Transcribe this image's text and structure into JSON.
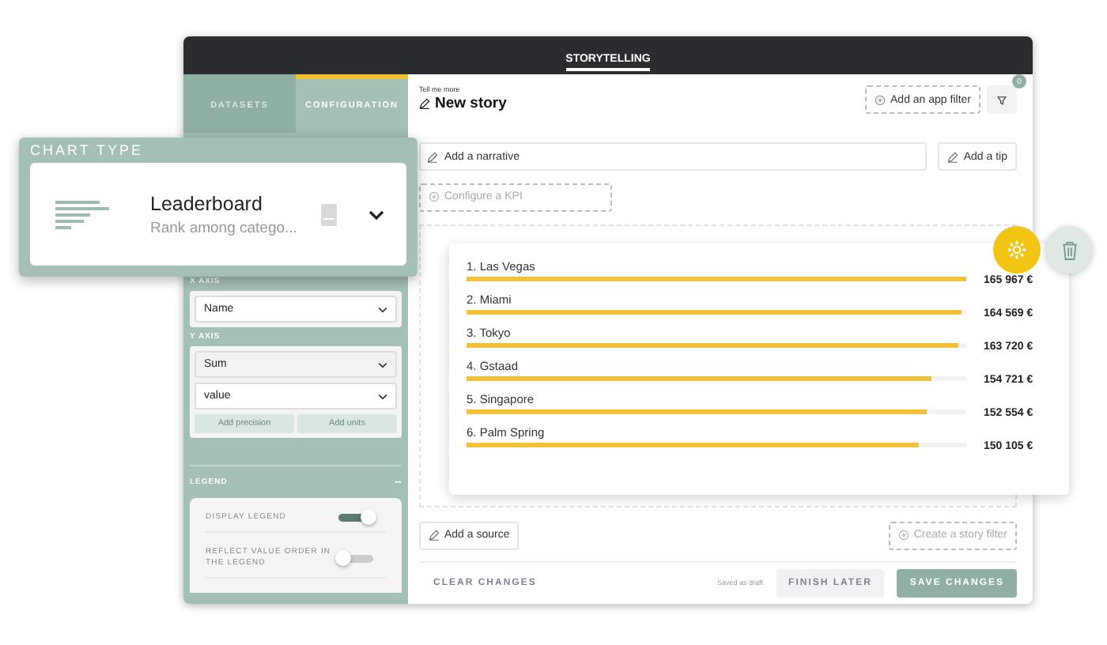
{
  "header": {
    "title": "STORYTELLING"
  },
  "sidebar": {
    "tabs": [
      {
        "label": "DATASETS",
        "selected": false
      },
      {
        "label": "CONFIGURATION",
        "selected": true
      }
    ],
    "x_axis": {
      "label": "X AXIS",
      "select": "Name"
    },
    "y_axis": {
      "label": "Y AXIS",
      "aggregation": "Sum",
      "field": "value",
      "buttons": [
        "Add precision",
        "Add units"
      ]
    },
    "legend": {
      "label": "LEGEND",
      "collapse": "–",
      "toggles": [
        {
          "label": "DISPLAY LEGEND",
          "on": true
        },
        {
          "label": "REFLECT VALUE ORDER IN THE LEGEND",
          "on": false
        }
      ]
    }
  },
  "chart_type": {
    "label": "CHART TYPE",
    "name": "Leaderboard",
    "description": "Rank among catego..."
  },
  "story": {
    "hint": "Tell me more",
    "title": "New story",
    "app_filter": "Add an app filter",
    "filter_count": "0",
    "narrative_placeholder": "Add a narrative",
    "tip": "Add a tip",
    "kpi": "Configure a KPI",
    "source": "Add a source",
    "story_filter": "Create a story filter"
  },
  "leaderboard": [
    {
      "label": "1. Las Vegas",
      "value": "165 967 €",
      "level": 1.0
    },
    {
      "label": "2. Miami",
      "value": "164 569 €",
      "level": 0.99
    },
    {
      "label": "3. Tokyo",
      "value": "163 720 €",
      "level": 0.985
    },
    {
      "label": "4. Gstaad",
      "value": "154 721 €",
      "level": 0.93
    },
    {
      "label": "5. Singapore",
      "value": "152 554 €",
      "level": 0.92
    },
    {
      "label": "6. Palm Spring",
      "value": "150 105 €",
      "level": 0.905
    }
  ],
  "footer": {
    "clear": "CLEAR CHANGES",
    "status": "Saved as draft",
    "finish": "FINISH LATER",
    "save": "SAVE CHANGES"
  }
}
